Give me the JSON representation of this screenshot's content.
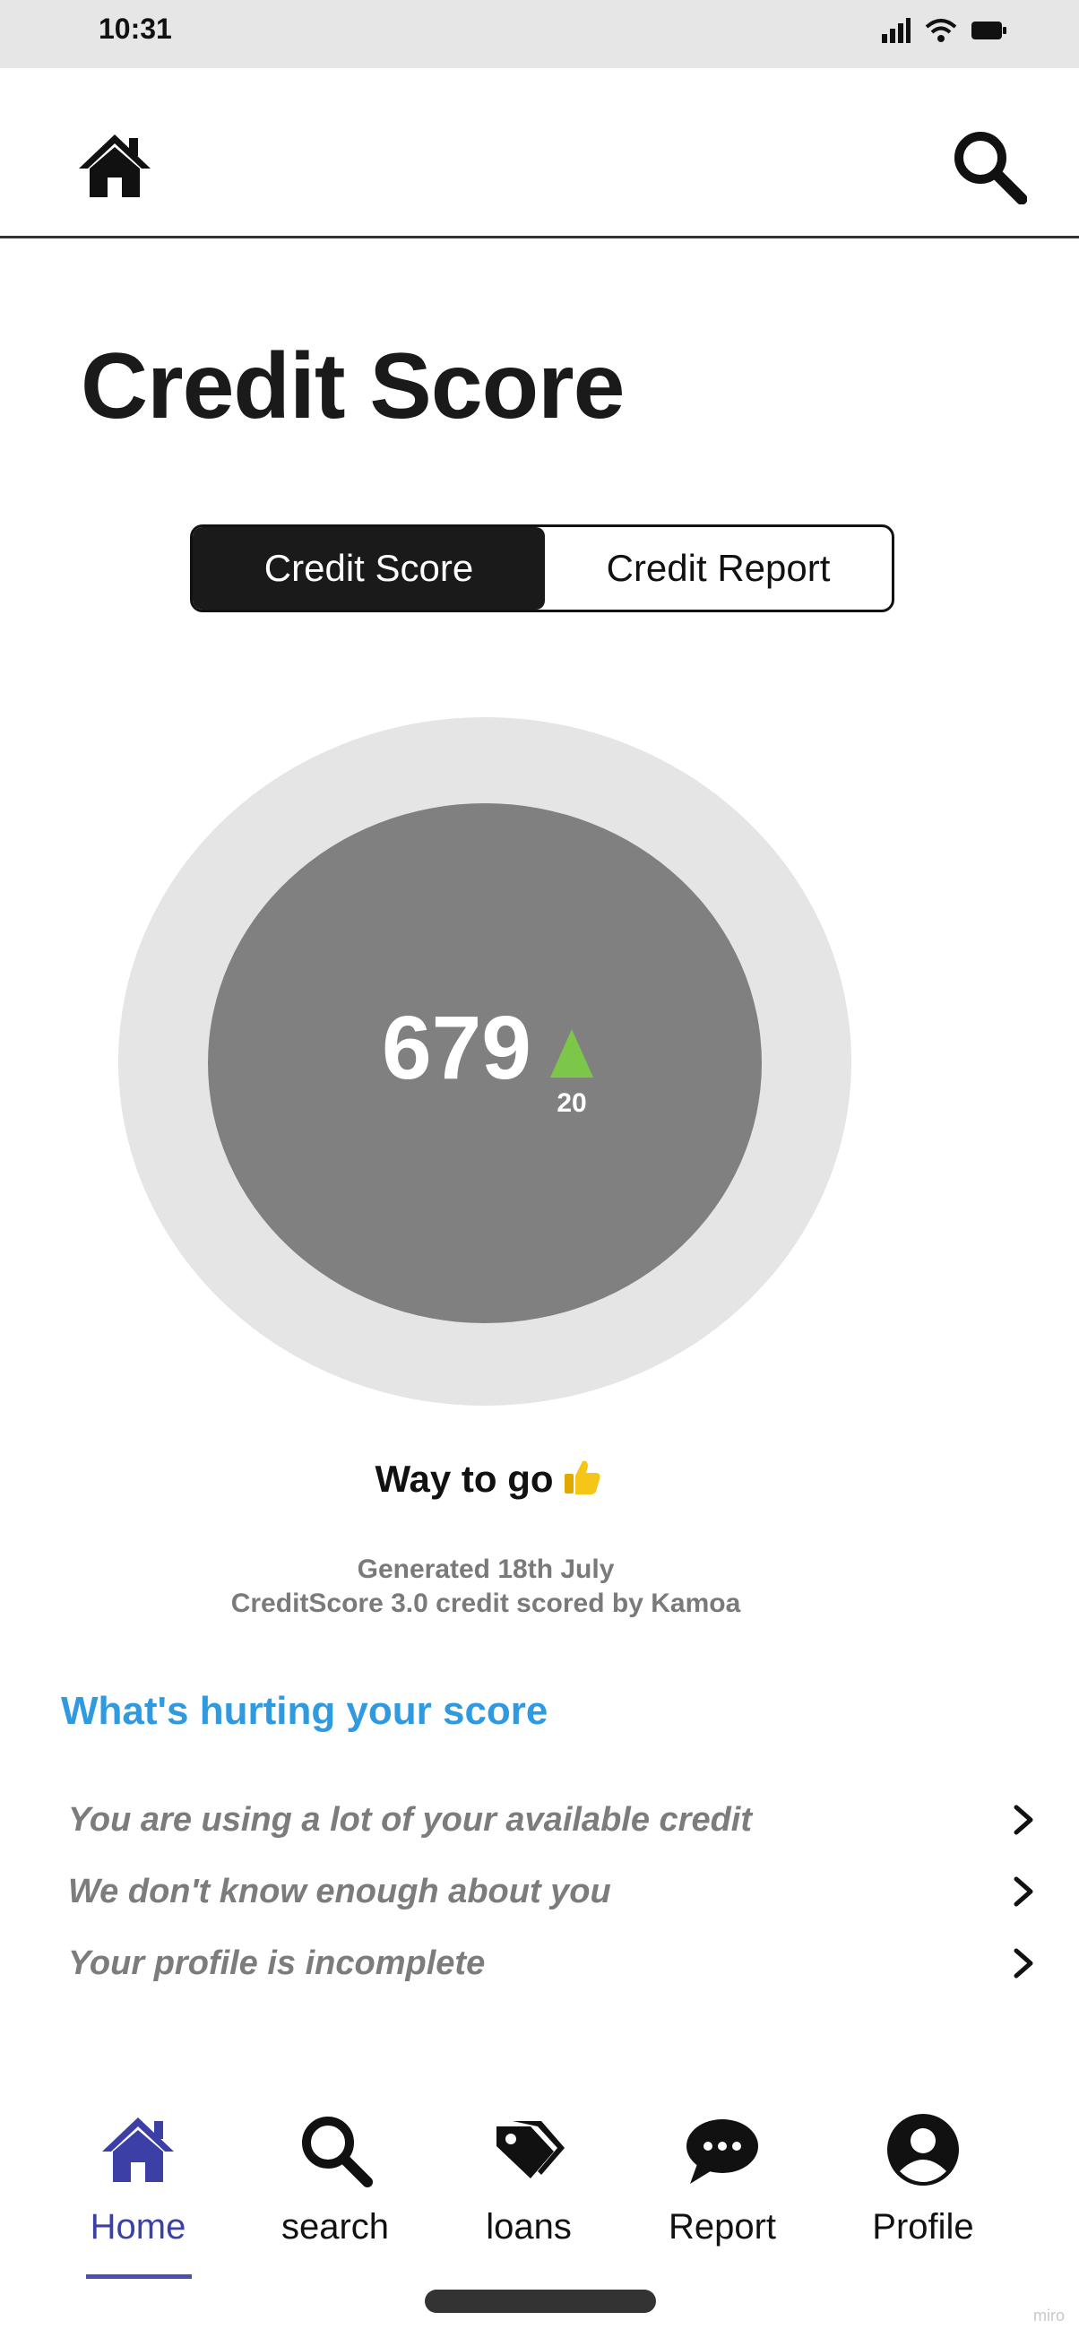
{
  "status_bar": {
    "time": "10:31"
  },
  "page": {
    "title": "Credit Score"
  },
  "segmented": {
    "options": [
      {
        "label": "Credit Score",
        "active": true
      },
      {
        "label": "Credit Report",
        "active": false
      }
    ]
  },
  "score": {
    "value": "679",
    "change": "20",
    "trend": "up",
    "trend_color": "#7cc64a"
  },
  "message": {
    "text": "Way to go"
  },
  "meta": {
    "generated": "Generated 18th July",
    "source": "CreditScore 3.0 credit scored by Kamoa"
  },
  "hurting": {
    "title": "What's hurting your score",
    "items": [
      {
        "label": "You are using a lot of your available credit"
      },
      {
        "label": "We don't know enough about you"
      },
      {
        "label": "Your profile is incomplete"
      }
    ]
  },
  "tab_bar": {
    "active_color": "#3b3fa6",
    "items": [
      {
        "label": "Home",
        "icon": "home-icon",
        "active": true
      },
      {
        "label": "search",
        "icon": "search-icon",
        "active": false
      },
      {
        "label": "loans",
        "icon": "tag-icon",
        "active": false
      },
      {
        "label": "Report",
        "icon": "chat-bubble-icon",
        "active": false
      },
      {
        "label": "Profile",
        "icon": "user-circle-icon",
        "active": false
      }
    ]
  },
  "watermark": "miro"
}
